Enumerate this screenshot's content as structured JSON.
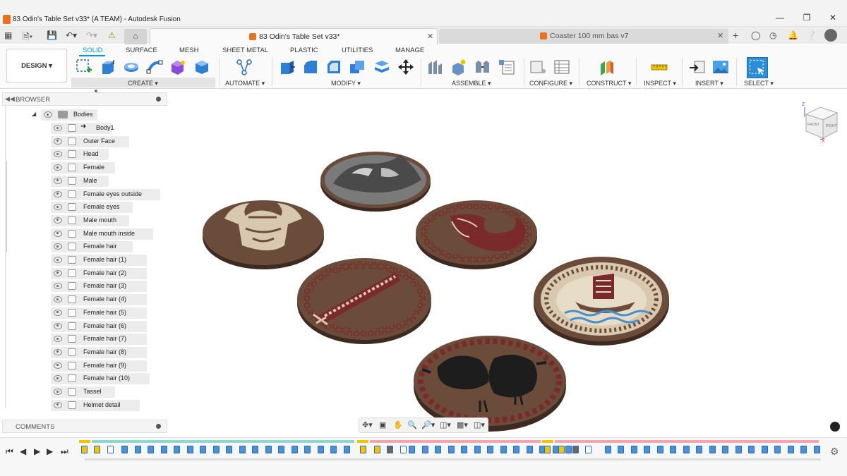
{
  "window": {
    "title": "83 Odin's Table Set v33* (A TEAM) - Autodesk Fusion"
  },
  "tabs": [
    {
      "label": "83 Odin's Table Set v33*",
      "active": true
    },
    {
      "label": "Coaster 100 mm bas v7",
      "active": false
    }
  ],
  "workspace": {
    "label": "DESIGN"
  },
  "ribbon_tabs": [
    "SOLID",
    "SURFACE",
    "MESH",
    "SHEET METAL",
    "PLASTIC",
    "UTILITIES",
    "MANAGE"
  ],
  "groups": {
    "create": "CREATE",
    "automate": "AUTOMATE",
    "modify": "MODIFY",
    "assemble": "ASSEMBLE",
    "configure": "CONFIGURE",
    "construct": "CONSTRUCT",
    "inspect": "INSPECT",
    "insert": "INSERT",
    "select": "SELECT"
  },
  "browser": {
    "title": "BROWSER",
    "folder": "Bodies",
    "items": [
      "Body1",
      "Outer Face",
      "Head",
      "Female",
      "Male",
      "Female eyes outside",
      "Female eyes",
      "Male mouth",
      "Male mouth inside",
      "Female hair",
      "Female hair (1)",
      "Female hair (2)",
      "Female hair (3)",
      "Female hair (4)",
      "Female hair (5)",
      "Female hair (6)",
      "Female hair (7)",
      "Female hair (8)",
      "Female hair (9)",
      "Female hair (10)",
      "Tassel",
      "Helmet detail"
    ]
  },
  "comments": {
    "title": "COMMENTS"
  },
  "viewcube": {
    "faces": [
      "FRONT",
      "RIGHT"
    ],
    "axes": [
      "Z",
      "X"
    ]
  },
  "colors": {
    "accent": "#0696d7",
    "coaster_wood": "#6b4c3b",
    "coaster_rim": "#4a3226",
    "red_inlay": "#7a2a2a",
    "beige_inlay": "#d8c8b0",
    "grey_inlay": "#8a8a8a"
  }
}
